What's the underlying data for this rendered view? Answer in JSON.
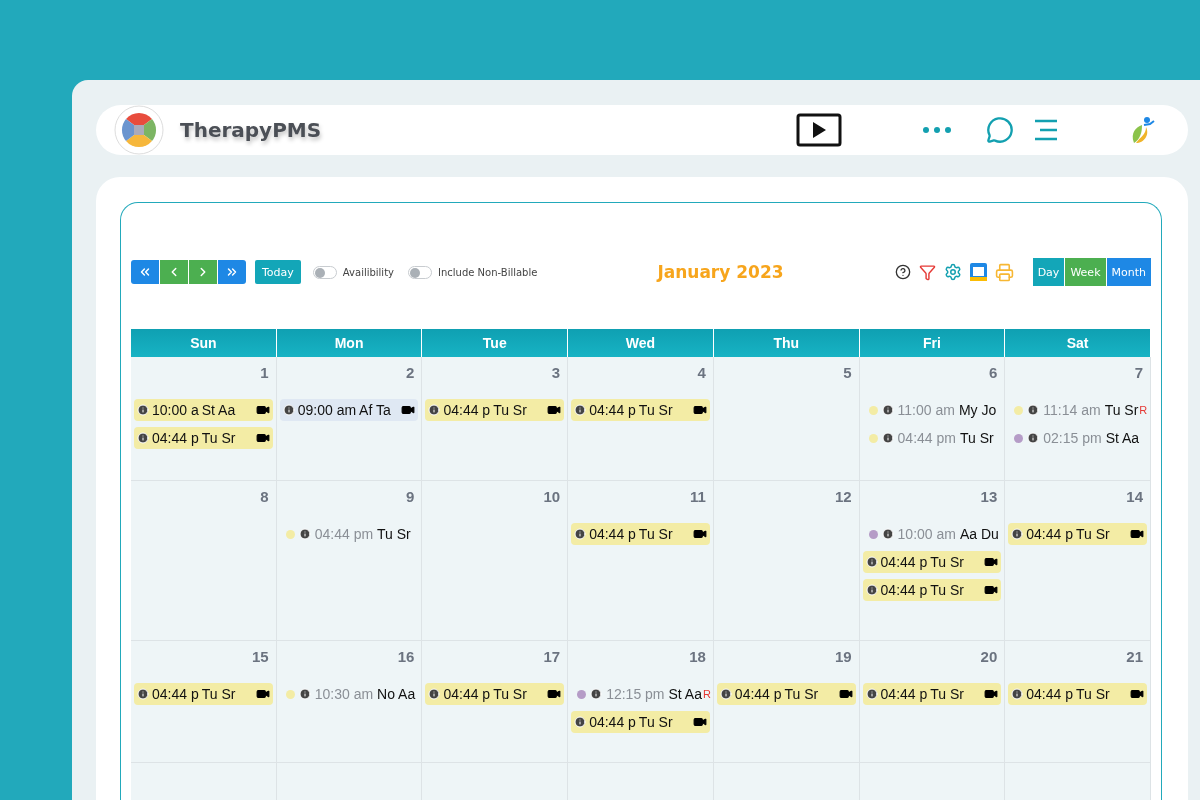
{
  "app": {
    "name": "TherapyPMS"
  },
  "toolbar": {
    "today": "Today",
    "toggles": [
      {
        "label": "Availibility",
        "on": false
      },
      {
        "label": "Include Non-Billable",
        "on": false
      }
    ],
    "title": "January 2023",
    "views": [
      {
        "label": "Day",
        "color": "#13a6b8"
      },
      {
        "label": "Week",
        "color": "#4caf50"
      },
      {
        "label": "Month",
        "color": "#1e88e5"
      }
    ]
  },
  "calendar": {
    "weekdays": [
      "Sun",
      "Mon",
      "Tue",
      "Wed",
      "Thu",
      "Fri",
      "Sat"
    ],
    "weeks": [
      [
        {
          "date": "1",
          "events": [
            {
              "kind": "block",
              "color": "#f3eca5",
              "time": "10:00 a",
              "name": "St Aa"
            },
            {
              "kind": "block",
              "color": "#f3eca5",
              "time": "04:44 p",
              "name": "Tu Sr"
            }
          ]
        },
        {
          "date": "2",
          "events": [
            {
              "kind": "block",
              "color": "#dfe8f3",
              "time": "09:00 am",
              "name": "Af Ta"
            }
          ]
        },
        {
          "date": "3",
          "events": [
            {
              "kind": "block",
              "color": "#f3eca5",
              "time": "04:44 p",
              "name": "Tu Sr"
            }
          ]
        },
        {
          "date": "4",
          "events": [
            {
              "kind": "block",
              "color": "#f3eca5",
              "time": "04:44 p",
              "name": "Tu Sr"
            }
          ]
        },
        {
          "date": "5"
        },
        {
          "date": "6",
          "events": [
            {
              "kind": "dot",
              "color": "#f3eca5",
              "time": "11:00 am",
              "name": "My Jo"
            },
            {
              "kind": "dot",
              "color": "#f3eca5",
              "time": "04:44 pm",
              "name": "Tu Sr"
            }
          ]
        },
        {
          "date": "7",
          "events": [
            {
              "kind": "dot",
              "color": "#f3eca5",
              "time": "11:14 am",
              "name": "Tu Sr",
              "tag": "R"
            },
            {
              "kind": "dot",
              "color": "#b59cc7",
              "time": "02:15 pm",
              "name": "St Aa"
            }
          ]
        }
      ],
      [
        {
          "date": "8"
        },
        {
          "date": "9",
          "events": [
            {
              "kind": "dot",
              "color": "#f3eca5",
              "time": "04:44 pm",
              "name": "Tu Sr"
            }
          ]
        },
        {
          "date": "10"
        },
        {
          "date": "11",
          "events": [
            {
              "kind": "block",
              "color": "#f3eca5",
              "time": "04:44 p",
              "name": "Tu Sr"
            }
          ]
        },
        {
          "date": "12"
        },
        {
          "date": "13",
          "events": [
            {
              "kind": "dot",
              "color": "#b59cc7",
              "time": "10:00 am",
              "name": "Aa Du"
            },
            {
              "kind": "block",
              "color": "#f3eca5",
              "time": "04:44 p",
              "name": "Tu Sr"
            },
            {
              "kind": "block",
              "color": "#f3eca5",
              "time": "04:44 p",
              "name": "Tu Sr"
            }
          ]
        },
        {
          "date": "14",
          "events": [
            {
              "kind": "block",
              "color": "#f3eca5",
              "time": "04:44 p",
              "name": "Tu Sr"
            }
          ]
        }
      ],
      [
        {
          "date": "15",
          "events": [
            {
              "kind": "block",
              "color": "#f3eca5",
              "time": "04:44 p",
              "name": "Tu Sr"
            }
          ]
        },
        {
          "date": "16",
          "events": [
            {
              "kind": "dot",
              "color": "#f3eca5",
              "time": "10:30 am",
              "name": "No Aa"
            }
          ]
        },
        {
          "date": "17",
          "events": [
            {
              "kind": "block",
              "color": "#f3eca5",
              "time": "04:44 p",
              "name": "Tu Sr"
            }
          ]
        },
        {
          "date": "18",
          "events": [
            {
              "kind": "dot",
              "color": "#b59cc7",
              "time": "12:15 pm",
              "name": "St Aa",
              "tag": "R"
            },
            {
              "kind": "block",
              "color": "#f3eca5",
              "time": "04:44 p",
              "name": "Tu Sr"
            }
          ]
        },
        {
          "date": "19",
          "events": [
            {
              "kind": "block",
              "color": "#f3eca5",
              "time": "04:44 p",
              "name": "Tu Sr"
            }
          ]
        },
        {
          "date": "20",
          "events": [
            {
              "kind": "block",
              "color": "#f3eca5",
              "time": "04:44 p",
              "name": "Tu Sr"
            }
          ]
        },
        {
          "date": "21",
          "events": [
            {
              "kind": "block",
              "color": "#f3eca5",
              "time": "04:44 p",
              "name": "Tu Sr"
            }
          ]
        }
      ]
    ]
  }
}
